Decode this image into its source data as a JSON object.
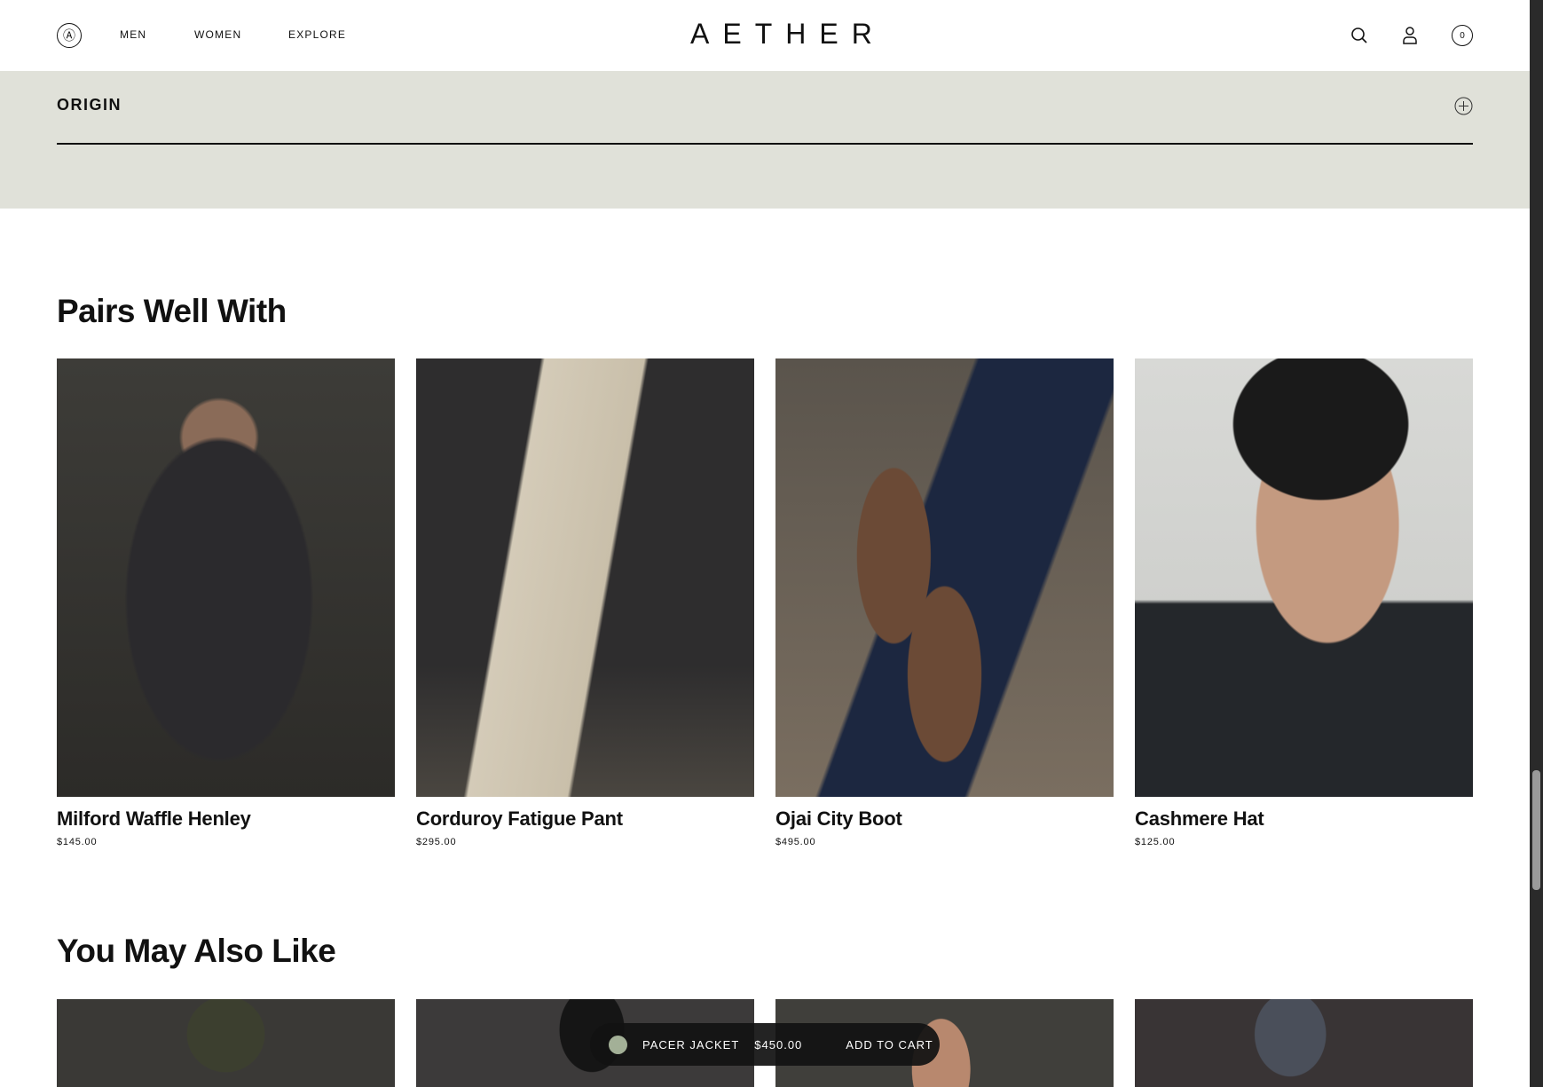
{
  "header": {
    "brand": "AETHER",
    "nav": [
      "MEN",
      "WOMEN",
      "EXPLORE"
    ],
    "logo_icon": "aether-logo-icon",
    "icons": [
      "search-icon",
      "user-icon",
      "cart-icon"
    ],
    "cart_count": "0"
  },
  "origin": {
    "title": "ORIGIN",
    "icon": "plus-circle-icon"
  },
  "pairs": {
    "title": "Pairs Well With",
    "items": [
      {
        "name": "Milford Waffle Henley",
        "price": "$145.00"
      },
      {
        "name": "Corduroy Fatigue Pant",
        "price": "$295.00"
      },
      {
        "name": "Ojai City Boot",
        "price": "$495.00"
      },
      {
        "name": "Cashmere Hat",
        "price": "$125.00"
      }
    ]
  },
  "also": {
    "title": "You May Also Like"
  },
  "sticky": {
    "product": "PACER JACKET",
    "price": "$450.00",
    "cta": "ADD TO CART",
    "swatch_color": "#a3b097"
  }
}
